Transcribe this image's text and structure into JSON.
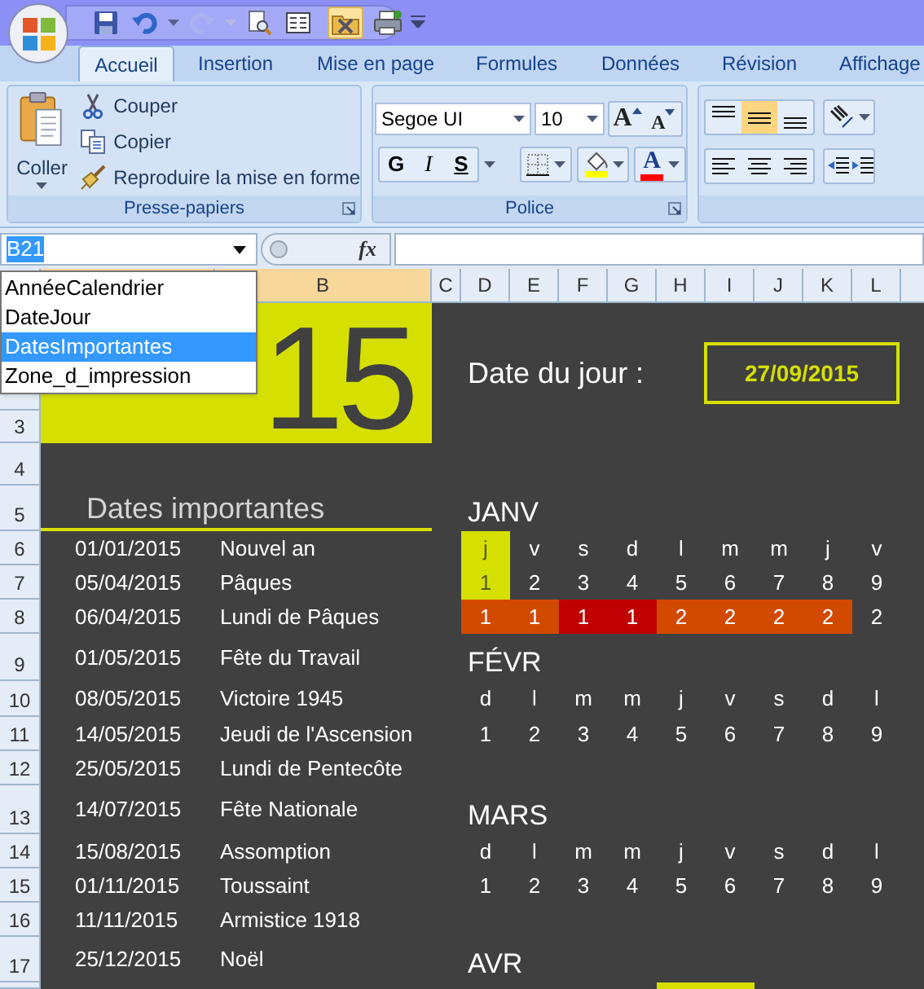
{
  "quick_access": [
    {
      "kind": "save",
      "disabled": false,
      "pressed": false
    },
    {
      "kind": "undo",
      "disabled": false,
      "pressed": false
    },
    {
      "kind": "redo",
      "disabled": true,
      "pressed": false
    },
    {
      "kind": "preview",
      "disabled": false,
      "pressed": false
    },
    {
      "kind": "form",
      "disabled": false,
      "pressed": false
    },
    {
      "kind": "tools",
      "disabled": false,
      "pressed": true
    },
    {
      "kind": "print",
      "disabled": false,
      "pressed": false
    }
  ],
  "tabs": [
    {
      "label": "Accueil",
      "selected": true
    },
    {
      "label": "Insertion",
      "selected": false
    },
    {
      "label": "Mise en page",
      "selected": false
    },
    {
      "label": "Formules",
      "selected": false
    },
    {
      "label": "Données",
      "selected": false
    },
    {
      "label": "Révision",
      "selected": false
    },
    {
      "label": "Affichage",
      "selected": false
    }
  ],
  "clipboard": {
    "paste": "Coller",
    "cut": "Couper",
    "copy": "Copier",
    "format_painter": "Reproduire la mise en forme",
    "group_label": "Presse-papiers"
  },
  "font": {
    "name": "Segoe UI",
    "size": "10",
    "grow": "A",
    "shrink": "A",
    "bold": "G",
    "italic": "I",
    "underline": "S",
    "color_letter": "A",
    "group_label": "Police"
  },
  "alignment": {
    "vertical": [
      {
        "kind": "top",
        "selected": false
      },
      {
        "kind": "middle",
        "selected": true
      },
      {
        "kind": "bottom",
        "selected": false
      }
    ],
    "horizontal": [
      {
        "kind": "left",
        "selected": false
      },
      {
        "kind": "center",
        "selected": false
      },
      {
        "kind": "right",
        "selected": false
      }
    ]
  },
  "name_box": {
    "value": "B21"
  },
  "formula_bar": {
    "fx": "fx"
  },
  "name_list": [
    {
      "label": "AnnéeCalendrier",
      "selected": false
    },
    {
      "label": "DateJour",
      "selected": false
    },
    {
      "label": "DatesImportantes",
      "selected": true
    },
    {
      "label": "Zone_d_impression",
      "selected": false
    }
  ],
  "columns": [
    {
      "label": "B",
      "selected": true
    },
    {
      "label": "C",
      "selected": false
    },
    {
      "label": "D",
      "selected": false
    },
    {
      "label": "E",
      "selected": false
    },
    {
      "label": "F",
      "selected": false
    },
    {
      "label": "G",
      "selected": false
    },
    {
      "label": "H",
      "selected": false
    },
    {
      "label": "I",
      "selected": false
    },
    {
      "label": "J",
      "selected": false
    },
    {
      "label": "K",
      "selected": false
    },
    {
      "label": "L",
      "selected": false
    }
  ],
  "rows": [
    "3",
    "4",
    "5",
    "6",
    "7",
    "8",
    "9",
    "10",
    "11",
    "12",
    "13",
    "14",
    "15",
    "16",
    "17"
  ],
  "year": "15",
  "today_label": "Date du jour :",
  "today": "27/09/2015",
  "important": {
    "title": "Dates importantes",
    "items": [
      {
        "date": "01/01/2015",
        "name": "Nouvel an"
      },
      {
        "date": "05/04/2015",
        "name": "Pâques"
      },
      {
        "date": "06/04/2015",
        "name": "Lundi de Pâques"
      },
      {
        "date": "01/05/2015",
        "name": "Fête du Travail"
      },
      {
        "date": "08/05/2015",
        "name": "Victoire 1945"
      },
      {
        "date": "14/05/2015",
        "name": "Jeudi de l'Ascension"
      },
      {
        "date": "25/05/2015",
        "name": "Lundi de Pentecôte"
      },
      {
        "date": "14/07/2015",
        "name": "Fête Nationale"
      },
      {
        "date": "15/08/2015",
        "name": "Assomption"
      },
      {
        "date": "01/11/2015",
        "name": "Toussaint"
      },
      {
        "date": "11/11/2015",
        "name": "Armistice 1918"
      },
      {
        "date": "25/12/2015",
        "name": "Noël"
      }
    ]
  },
  "months": [
    {
      "name": "JANV",
      "days": [
        {
          "weekday": "j",
          "day": "1",
          "highlight": true
        },
        {
          "weekday": "v",
          "day": "2",
          "highlight": false
        },
        {
          "weekday": "s",
          "day": "3",
          "highlight": false
        },
        {
          "weekday": "d",
          "day": "4",
          "highlight": false
        },
        {
          "weekday": "l",
          "day": "5",
          "highlight": false
        },
        {
          "weekday": "m",
          "day": "6",
          "highlight": false
        },
        {
          "weekday": "m",
          "day": "7",
          "highlight": false
        },
        {
          "weekday": "j",
          "day": "8",
          "highlight": false
        },
        {
          "weekday": "v",
          "day": "9",
          "highlight": false
        }
      ],
      "weeks": [
        {
          "value": "1",
          "color": "#d24a00"
        },
        {
          "value": "1",
          "color": "#d24a00"
        },
        {
          "value": "1",
          "color": "#c00000"
        },
        {
          "value": "1",
          "color": "#c00000"
        },
        {
          "value": "2",
          "color": "#d24a00"
        },
        {
          "value": "2",
          "color": "#d24a00"
        },
        {
          "value": "2",
          "color": "#d24a00"
        },
        {
          "value": "2",
          "color": "#d24a00"
        },
        {
          "value": "2"
        }
      ]
    },
    {
      "name": "FÉVR",
      "days": [
        {
          "weekday": "d",
          "day": "1",
          "highlight": false
        },
        {
          "weekday": "l",
          "day": "2",
          "highlight": false
        },
        {
          "weekday": "m",
          "day": "3",
          "highlight": false
        },
        {
          "weekday": "m",
          "day": "4",
          "highlight": false
        },
        {
          "weekday": "j",
          "day": "5",
          "highlight": false
        },
        {
          "weekday": "v",
          "day": "6",
          "highlight": false
        },
        {
          "weekday": "s",
          "day": "7",
          "highlight": false
        },
        {
          "weekday": "d",
          "day": "8",
          "highlight": false
        },
        {
          "weekday": "l",
          "day": "9",
          "highlight": false
        }
      ]
    },
    {
      "name": "MARS",
      "days": [
        {
          "weekday": "d",
          "day": "1",
          "highlight": false
        },
        {
          "weekday": "l",
          "day": "2",
          "highlight": false
        },
        {
          "weekday": "m",
          "day": "3",
          "highlight": false
        },
        {
          "weekday": "m",
          "day": "4",
          "highlight": false
        },
        {
          "weekday": "j",
          "day": "5",
          "highlight": false
        },
        {
          "weekday": "v",
          "day": "6",
          "highlight": false
        },
        {
          "weekday": "s",
          "day": "7",
          "highlight": false
        },
        {
          "weekday": "d",
          "day": "8",
          "highlight": false
        },
        {
          "weekday": "l",
          "day": "9",
          "highlight": false
        }
      ]
    },
    {
      "name": "AVR",
      "next_row_highlight": true
    }
  ]
}
